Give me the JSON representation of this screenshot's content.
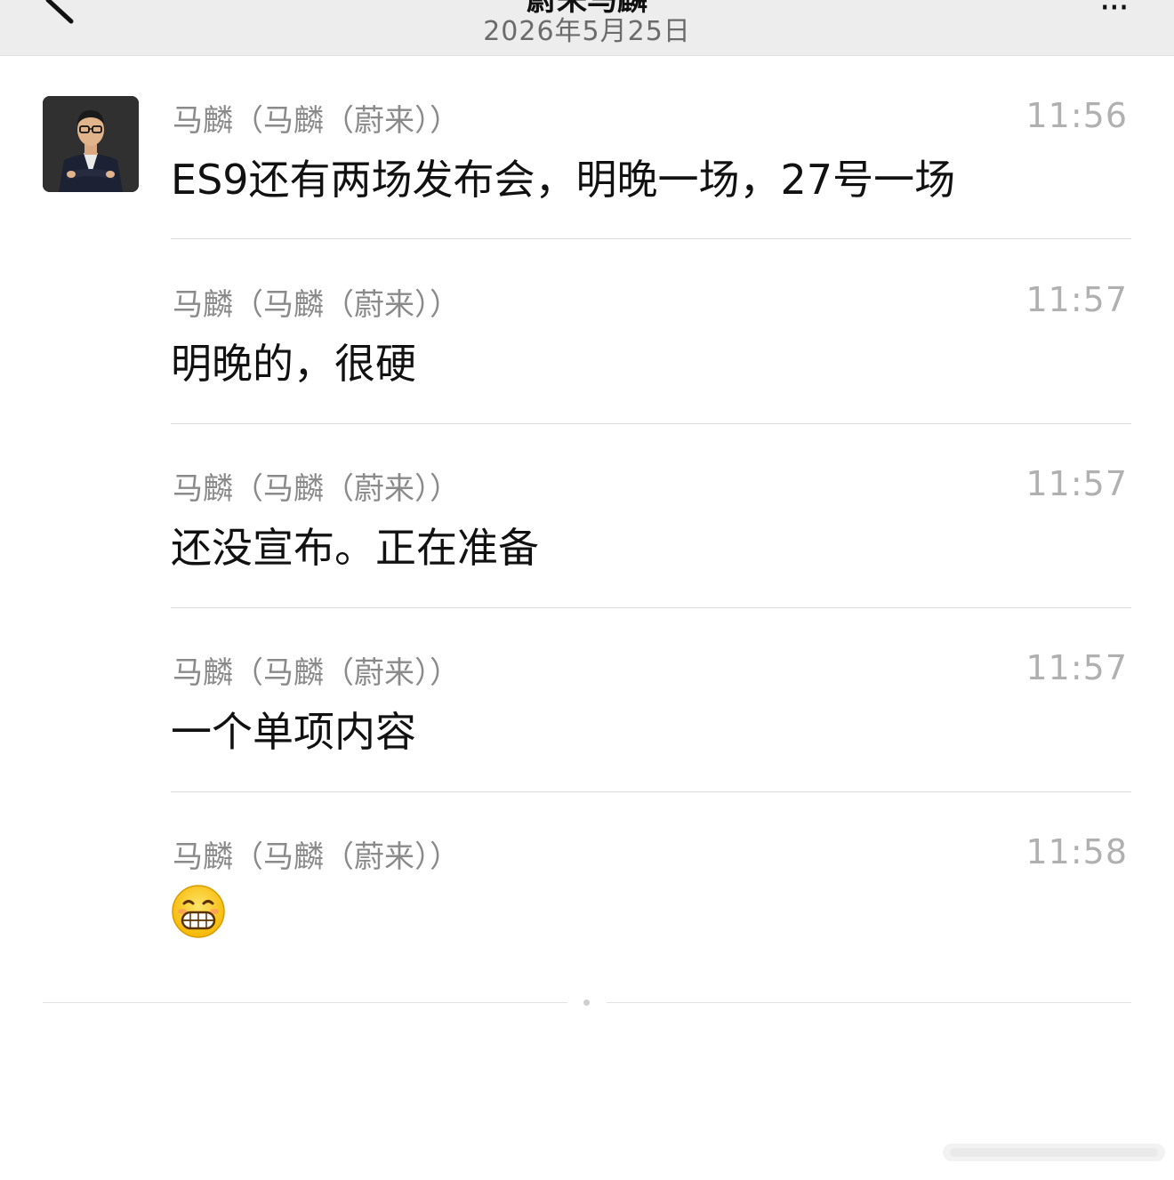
{
  "header": {
    "title": "蔚来马麟",
    "date": "2026年5月25日",
    "more_label": "···"
  },
  "messages": [
    {
      "sender": "马麟（马麟（蔚来））",
      "time": "11:56",
      "text": "ES9还有两场发布会，明晚一场，27号一场"
    },
    {
      "sender": "马麟（马麟（蔚来））",
      "time": "11:57",
      "text": "明晚的，很硬"
    },
    {
      "sender": "马麟（马麟（蔚来））",
      "time": "11:57",
      "text": "还没宣布。正在准备"
    },
    {
      "sender": "马麟（马麟（蔚来））",
      "time": "11:57",
      "text": "一个单项内容"
    },
    {
      "sender": "马麟（马麟（蔚来））",
      "time": "11:58",
      "emoji": "grinning-face-emoji"
    }
  ],
  "icons": {
    "back": "chevron-left-icon",
    "more": "more-dots-icon"
  }
}
